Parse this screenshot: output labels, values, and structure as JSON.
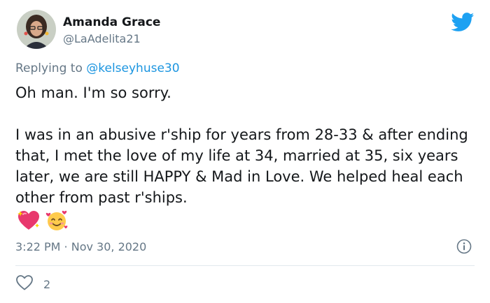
{
  "author": {
    "name": "Amanda Grace",
    "handle": "@LaAdelita21"
  },
  "icons": {
    "brand": "twitter-bird-icon",
    "info": "info-icon",
    "like": "heart-outline-icon",
    "emoji_1": "sparkling-heart-icon",
    "emoji_2": "smiling-face-with-hearts-icon"
  },
  "reply": {
    "prefix": "Replying to",
    "mention": "@kelseyhuse30"
  },
  "tweet": {
    "paragraph_1": "Oh man. I'm so sorry.",
    "paragraph_2": "I was in an abusive r'ship for years from 28-33 & after ending that, I met the love of my life at 34, married at 35, six years later, we are still HAPPY & Mad in Love.  We helped heal each other from past r'ships.",
    "timestamp": "3:22 PM · Nov 30, 2020"
  },
  "engagement": {
    "likes": "2"
  },
  "colors": {
    "twitter_blue": "#1da1f2",
    "mention_blue": "#1b95e0",
    "secondary_text": "#657786",
    "primary_text": "#14171a",
    "divider": "#e1e8ed"
  }
}
